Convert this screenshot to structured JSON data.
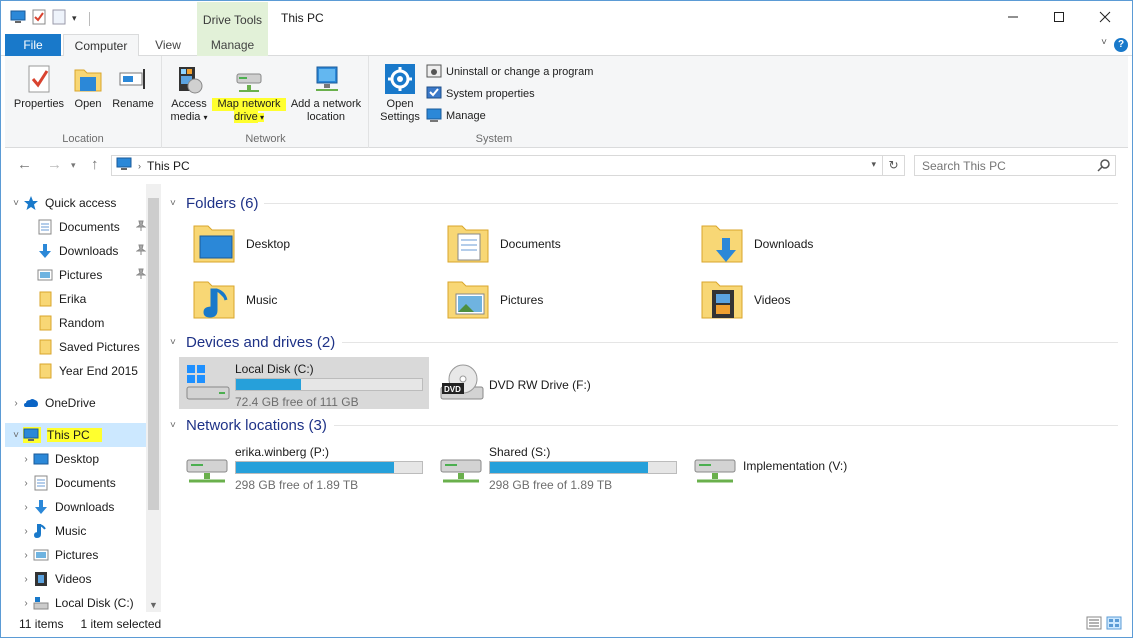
{
  "window": {
    "title": "This PC",
    "context_tab_label": "Drive Tools"
  },
  "tabs": {
    "file": "File",
    "computer": "Computer",
    "view": "View",
    "manage": "Manage",
    "help": "?"
  },
  "ribbon": {
    "location": {
      "label": "Location",
      "properties": "Properties",
      "open": "Open",
      "rename": "Rename"
    },
    "network": {
      "label": "Network",
      "access_media_1": "Access",
      "access_media_2": "media",
      "map_drive_1": "Map network",
      "map_drive_2": "drive",
      "add_location_1": "Add a network",
      "add_location_2": "location"
    },
    "system": {
      "label": "System",
      "open_settings_1": "Open",
      "open_settings_2": "Settings",
      "uninstall": "Uninstall or change a program",
      "system_properties": "System properties",
      "manage": "Manage"
    }
  },
  "address": {
    "path": "This PC",
    "search_placeholder": "Search This PC"
  },
  "nav_pane": {
    "quick_access": "Quick access",
    "qa_items": [
      "Documents",
      "Downloads",
      "Pictures",
      "Erika",
      "Random",
      "Saved Pictures",
      "Year End 2015"
    ],
    "onedrive": "OneDrive",
    "this_pc": "This PC",
    "pc_items": [
      "Desktop",
      "Documents",
      "Downloads",
      "Music",
      "Pictures",
      "Videos",
      "Local Disk (C:)"
    ]
  },
  "content": {
    "folders_header": "Folders (6)",
    "folders": [
      "Desktop",
      "Documents",
      "Downloads",
      "Music",
      "Pictures",
      "Videos"
    ],
    "devices_header": "Devices and drives (2)",
    "local_disk": {
      "name": "Local Disk (C:)",
      "free": "72.4 GB free of 111 GB",
      "used_fraction": 0.35
    },
    "dvd": {
      "name": "DVD RW Drive (F:)"
    },
    "network_header": "Network locations (3)",
    "network": [
      {
        "name": "erika.winberg (P:)",
        "free": "298 GB free of 1.89 TB",
        "used_fraction": 0.85
      },
      {
        "name": "Shared (S:)",
        "free": "298 GB free of 1.89 TB",
        "used_fraction": 0.85
      },
      {
        "name": "Implementation (V:)"
      }
    ]
  },
  "status": {
    "items": "11 items",
    "selected": "1 item selected"
  },
  "colors": {
    "accent": "#1979ca",
    "context_tab": "#e2f1d8",
    "highlight": "#ffff2e",
    "selection": "#cce8ff",
    "header_text": "#1e3287",
    "bar_fill": "#26a0da"
  }
}
